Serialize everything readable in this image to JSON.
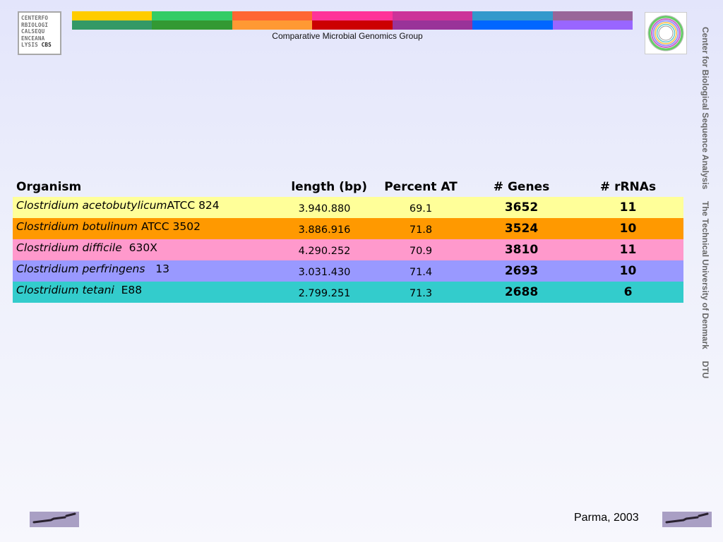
{
  "header": {
    "cbs_logo_lines": [
      "CENTERFO",
      "RBIOLOGI",
      "CALSEQU",
      "ENCEANA"
    ],
    "cbs_logo_last_prefix": "LYSIS ",
    "cbs_logo_last_bold": "CBS",
    "subtitle": "Comparative Microbial Genomics Group",
    "bars_top": [
      "#ffcc00",
      "#33cc66",
      "#ff6633",
      "#ff3399",
      "#cc3399",
      "#3399cc",
      "#996699"
    ],
    "bars_bottom": [
      "#339966",
      "#339933",
      "#ff9933",
      "#cc0000",
      "#993399",
      "#0066ff",
      "#9966ff"
    ]
  },
  "sidebar_text": "Center for Biological Sequence Analysis     The Technical University of Denmark     DTU",
  "table": {
    "columns": [
      "Organism",
      "length (bp)",
      "Percent AT",
      "# Genes",
      "# rRNAs"
    ],
    "rows": [
      {
        "species": "Clostridium acetobutylicum",
        "strain": "ATCC 824",
        "length": "3.940.880",
        "percent_at": "69.1",
        "genes": "3652",
        "rrnas": "11",
        "color": "#ffff99"
      },
      {
        "species": "Clostridium botulinum",
        "strain": " ATCC 3502",
        "length": "3.886.916",
        "percent_at": "71.8",
        "genes": "3524",
        "rrnas": "10",
        "color": "#ff9900"
      },
      {
        "species": "Clostridium difficile",
        "strain": "  630X",
        "length": "4.290.252",
        "percent_at": "70.9",
        "genes": "3810",
        "rrnas": "11",
        "color": "#ff99cc"
      },
      {
        "species": "Clostridium perfringens",
        "strain": "   13",
        "length": "3.031.430",
        "percent_at": "71.4",
        "genes": "2693",
        "rrnas": "10",
        "color": "#9999ff"
      },
      {
        "species": "Clostridium tetani",
        "strain": "  E88",
        "length": "2.799.251",
        "percent_at": "71.3",
        "genes": "2688",
        "rrnas": "6",
        "color": "#33cccc"
      }
    ]
  },
  "footer": {
    "place_date": "Parma, 2003"
  }
}
